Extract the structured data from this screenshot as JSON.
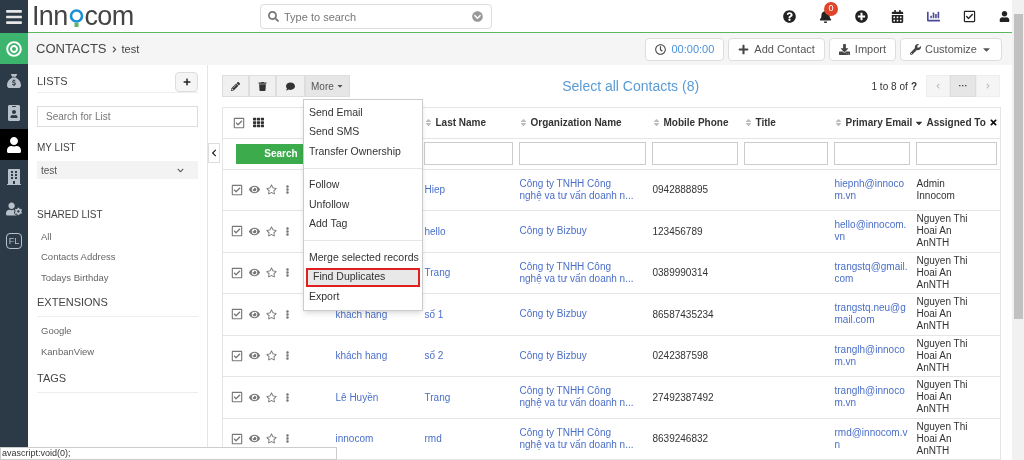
{
  "sidebar": {
    "items": [
      {
        "kind": "target",
        "selected": false
      },
      {
        "kind": "money",
        "selected": false
      },
      {
        "kind": "card",
        "selected": false
      },
      {
        "kind": "person",
        "selected": true
      },
      {
        "kind": "building",
        "selected": false
      },
      {
        "kind": "usergear",
        "selected": false
      },
      {
        "kind": "text",
        "label": "FL",
        "selected": false
      }
    ]
  },
  "topbar": {
    "logo": {
      "before": "Inn",
      "after": "com"
    },
    "search": {
      "placeholder": "Type to search"
    },
    "notifications": "0"
  },
  "breadcrumb": {
    "module": "CONTACTS",
    "current": "test"
  },
  "actions": {
    "timer": "00:00:00",
    "add": "Add Contact",
    "import": "Import",
    "customize": "Customize"
  },
  "lists_panel": {
    "title": "LISTS",
    "search": {
      "placeholder": "Search for List"
    },
    "my_list": {
      "title": "MY LIST",
      "value": "test"
    },
    "shared_list": {
      "title": "SHARED LIST",
      "items": [
        "All",
        "Contacts Address",
        "Todays Birthday"
      ]
    },
    "extensions": {
      "title": "EXTENSIONS",
      "items": [
        "Google",
        "KanbanView"
      ]
    },
    "tags": {
      "title": "TAGS"
    }
  },
  "toolbar": {
    "more": "More",
    "select_all": "Select all Contacts (8)",
    "pager": {
      "range": "1 to 8",
      "of": "of",
      "total": "?",
      "more": "···"
    }
  },
  "more_menu": {
    "groups": [
      [
        {
          "label": "Send Email",
          "highlighted": false
        },
        {
          "label": "Send SMS",
          "highlighted": false
        },
        {
          "label": "Transfer Ownership",
          "highlighted": false
        }
      ],
      [
        {
          "label": "Follow",
          "highlighted": false
        },
        {
          "label": "Unfollow",
          "highlighted": false
        },
        {
          "label": "Add Tag",
          "highlighted": false
        }
      ],
      [
        {
          "label": "Merge selected records",
          "highlighted": false
        },
        {
          "label": "Find Duplicates",
          "highlighted": true
        },
        {
          "label": "Export",
          "highlighted": false
        }
      ]
    ]
  },
  "table": {
    "search_button": "Search",
    "select_all_checked": true,
    "columns": [
      {
        "label": "Last Name",
        "sorted": false
      },
      {
        "label": "Organization Name",
        "sorted": false
      },
      {
        "label": "Mobile Phone",
        "sorted": false
      },
      {
        "label": "Title",
        "sorted": false
      },
      {
        "label": "Primary Email",
        "sorted": false
      },
      {
        "label": "Assigned To",
        "sorted": true,
        "closable": true
      }
    ],
    "rows": [
      {
        "checked": true,
        "last_name": "Hiep",
        "organization": "Công ty TNHH Công nghệ va tư vấn doanh n...",
        "mobile": "0942888895",
        "email": "hiepnh@innocom.vn",
        "assigned": "Admin Innocom"
      },
      {
        "checked": true,
        "last_name": "hello",
        "organization": "Công ty Bizbuy",
        "mobile": "123456789",
        "email": "hello@innocom.vn",
        "assigned": "Nguyen Thi Hoai An AnNTH"
      },
      {
        "checked": true,
        "last_name": "Trang",
        "organization": "Công ty TNHH Công nghệ va tư vấn doanh n...",
        "mobile": "0389990314",
        "email": "trangstq@gmail.com",
        "assigned": "Nguyen Thi Hoai An AnNTH"
      },
      {
        "checked": true,
        "first_name": "khách hang",
        "last_name": "số 1",
        "organization": "Công ty Bizbuy",
        "mobile": "86587435234",
        "email": "trangstq.neu@gmail.com",
        "assigned": "Nguyen Thi Hoai An AnNTH"
      },
      {
        "checked": true,
        "first_name": "khách hang",
        "last_name": "số 2",
        "organization": "Công ty Bizbuy",
        "mobile": "0242387598",
        "email": "tranglh@innocom.vn",
        "assigned": "Nguyen Thi Hoai An AnNTH"
      },
      {
        "checked": true,
        "first_name": "Lê Huyền",
        "last_name": "Trang",
        "organization": "Công ty TNHH Công nghệ va tư vấn doanh n...",
        "mobile": "27492387492",
        "email": "tranglh@innocom.vn",
        "assigned": "Nguyen Thi Hoai An AnNTH"
      },
      {
        "checked": true,
        "first_name": "innocom",
        "last_name": "rmd",
        "organization": "Công ty TNHH Công nghệ va tư vấn doanh n...",
        "mobile": "8639246832",
        "email": "rmd@innocom.vn",
        "assigned": "Nguyen Thi Hoai An AnNTH"
      }
    ]
  },
  "status_bar": "avascript:void(0);"
}
